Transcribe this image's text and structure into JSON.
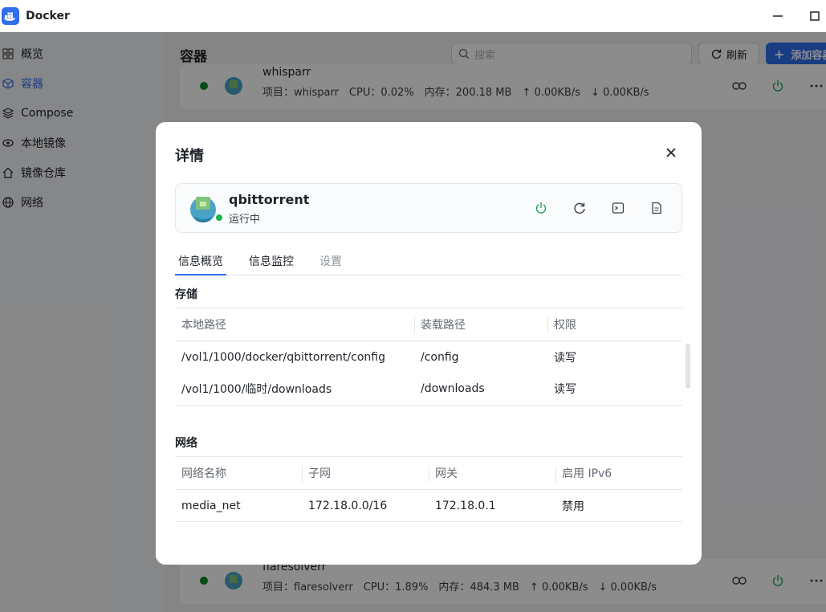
{
  "window": {
    "title": "Docker"
  },
  "sidebar": {
    "items": [
      {
        "label": "概览",
        "icon": "grid-icon",
        "active": false
      },
      {
        "label": "容器",
        "icon": "cube-icon",
        "active": true
      },
      {
        "label": "Compose",
        "icon": "layers-icon",
        "active": false
      },
      {
        "label": "本地镜像",
        "icon": "eye-icon",
        "active": false
      },
      {
        "label": "镜像仓库",
        "icon": "home-icon",
        "active": false
      },
      {
        "label": "网络",
        "icon": "globe-icon",
        "active": false
      }
    ]
  },
  "main": {
    "title": "容器",
    "search_placeholder": "搜索",
    "refresh_label": "刷新",
    "add_label": "添加容器",
    "cards": [
      {
        "name": "whisparr",
        "info": "项目：whisparr　CPU：0.02%　内存：200.18 MB　↑ 0.00KB/s　↓ 0.00KB/s"
      },
      {
        "name": "flaresolverr",
        "info": "项目：flaresolverr　CPU：1.89%　内存：484.3 MB　↑ 0.00KB/s　↓ 0.00KB/s"
      }
    ]
  },
  "modal": {
    "title": "详情",
    "container": {
      "name": "qbittorrent",
      "status": "运行中"
    },
    "tabs": [
      {
        "label": "信息概览",
        "state": "active"
      },
      {
        "label": "信息监控",
        "state": "normal"
      },
      {
        "label": "设置",
        "state": "disabled"
      }
    ],
    "storage": {
      "title": "存储",
      "headers": [
        "本地路径",
        "装载路径",
        "权限"
      ],
      "rows": [
        [
          "/vol1/1000/docker/qbittorrent/config",
          "/config",
          "读写"
        ],
        [
          "/vol1/1000/临时/downloads",
          "/downloads",
          "读写"
        ]
      ]
    },
    "network": {
      "title": "网络",
      "headers": [
        "网络名称",
        "子网",
        "网关",
        "启用 IPv6"
      ],
      "rows": [
        [
          "media_net",
          "172.18.0.0/16",
          "172.18.0.1",
          "禁用"
        ]
      ]
    }
  },
  "colors": {
    "accent": "#2f6fed",
    "running": "#19b24b",
    "power": "#19a35a"
  }
}
